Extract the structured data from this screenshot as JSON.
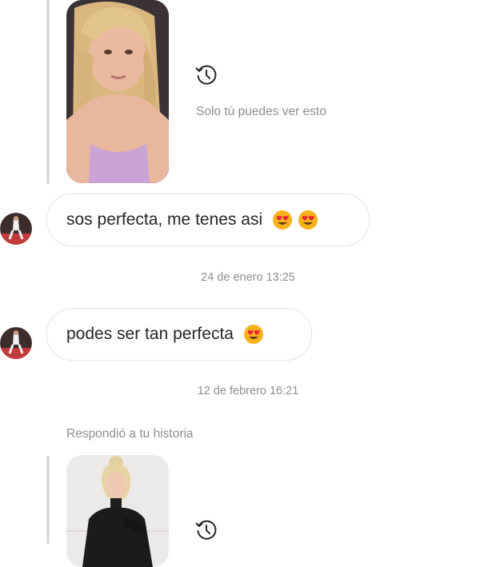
{
  "thread": {
    "story1": {
      "private_note": "Solo tú puedes ver esto",
      "icon": "history-icon"
    },
    "messages": [
      {
        "text": "sos perfecta, me tenes asi",
        "emoji": "heart-eyes-emoji",
        "emoji_count": 2
      },
      {
        "text": "podes ser tan perfecta",
        "emoji": "heart-eyes-emoji",
        "emoji_count": 1
      }
    ],
    "timestamps": [
      "24 de enero 13:25",
      "12 de febrero 16:21"
    ],
    "reply_label": "Respondió a tu historia",
    "story2": {
      "icon": "history-icon"
    }
  },
  "colors": {
    "bubble_border": "#e3e3e3",
    "meta_text": "#8e8e8e",
    "emoji_face": "#f7b21b",
    "emoji_heart": "#e8223b"
  }
}
